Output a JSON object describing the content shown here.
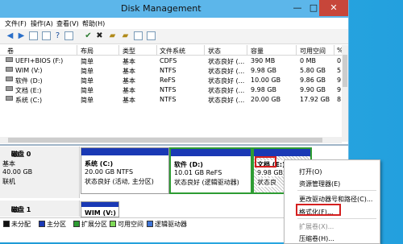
{
  "window": {
    "title": "Disk Management",
    "min": "—",
    "max": "□",
    "close": "✕"
  },
  "menu": [
    "文件(F)",
    "操作(A)",
    "查看(V)",
    "帮助(H)"
  ],
  "columns": [
    "卷",
    "布局",
    "类型",
    "文件系统",
    "状态",
    "容量",
    "可用空间",
    "%"
  ],
  "volumes": [
    {
      "name": "UEFI+BIOS (F:)",
      "layout": "简单",
      "type": "基本",
      "fs": "CDFS",
      "status": "状态良好 (...",
      "capacity": "390 MB",
      "free": "0 MB",
      "pct": "0"
    },
    {
      "name": "WIM (V:)",
      "layout": "简单",
      "type": "基本",
      "fs": "NTFS",
      "status": "状态良好 (...",
      "capacity": "9.98 GB",
      "free": "5.80 GB",
      "pct": "5"
    },
    {
      "name": "软件 (D:)",
      "layout": "简单",
      "type": "基本",
      "fs": "ReFS",
      "status": "状态良好 (...",
      "capacity": "10.00 GB",
      "free": "9.86 GB",
      "pct": "9"
    },
    {
      "name": "文档 (E:)",
      "layout": "简单",
      "type": "基本",
      "fs": "NTFS",
      "status": "状态良好 (...",
      "capacity": "9.98 GB",
      "free": "9.90 GB",
      "pct": "9"
    },
    {
      "name": "系统 (C:)",
      "layout": "简单",
      "type": "基本",
      "fs": "NTFS",
      "status": "状态良好 (...",
      "capacity": "20.00 GB",
      "free": "17.92 GB",
      "pct": "8"
    }
  ],
  "disk0": {
    "name": "磁盘 0",
    "type": "基本",
    "size": "40.00 GB",
    "state": "联机",
    "p1": {
      "name": "系统 (C:)",
      "size": "20.00 GB NTFS",
      "status": "状态良好 (活动, 主分区)"
    },
    "p2": {
      "name": "软件 (D:)",
      "size": "10.01 GB ReFS",
      "status": "状态良好 (逻辑驱动器)"
    },
    "p3": {
      "name": "文档 (E:)",
      "size": "9.98 GB",
      "status": "状态良"
    }
  },
  "disk1": {
    "name": "磁盘 1",
    "p1": {
      "name": "WIM (V:)"
    }
  },
  "legend": [
    "未分配",
    "主分区",
    "扩展分区",
    "可用空间",
    "逻辑驱动器"
  ],
  "context_menu": {
    "open": "打开(O)",
    "explore": "资源管理器(E)",
    "change_letter": "更改驱动器号和路径(C)...",
    "format": "格式化(F)...",
    "extend": "扩展卷(X)...",
    "shrink": "压缩卷(H)..."
  },
  "colors": {
    "accent": "#5cb6ea",
    "primary_bar": "#1a39b5",
    "highlight": "#d41f1f"
  }
}
